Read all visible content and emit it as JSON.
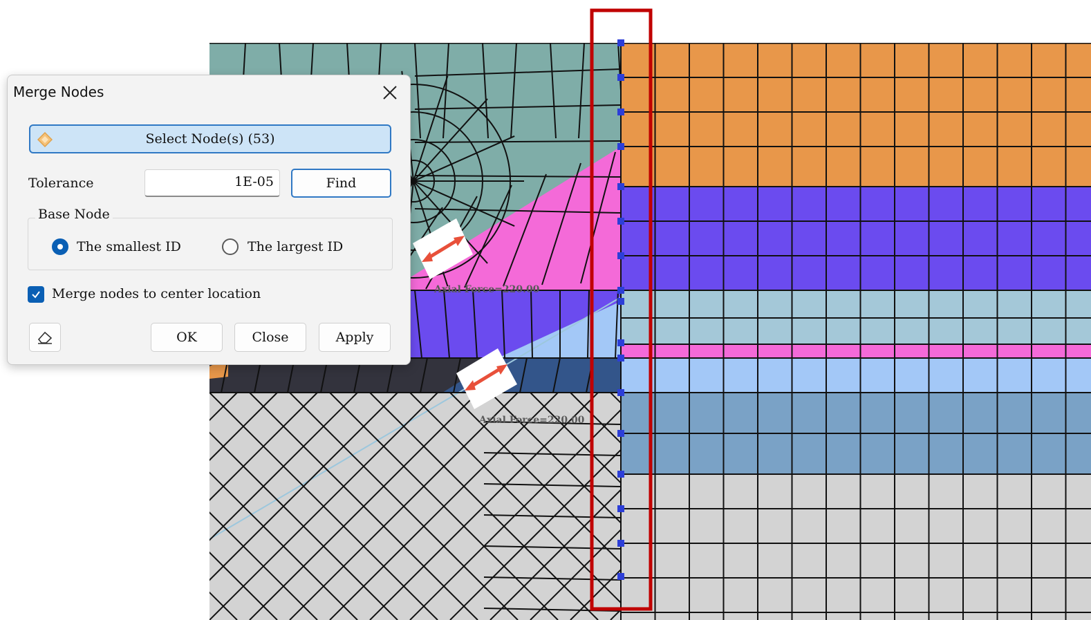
{
  "viewport": {
    "axial_label_1": "Axial Force=220.00",
    "axial_label_2": "Axial Force=220.00",
    "colors": {
      "teal": "#7fada8",
      "orange": "#e8974a",
      "pink": "#f46ad8",
      "purple": "#6b4bef",
      "light_blue": "#a4c8d8",
      "sky_blue": "#a3c8f7",
      "steel_blue": "#7aa2c6",
      "dark_blue": "#33558a",
      "dark_gray": "#33333d",
      "light_gray": "#d3d3d3",
      "node_marker": "#2c3ed8",
      "selection_box": "#c00000",
      "force_arrow": "#e8503a"
    }
  },
  "dialog": {
    "title": "Merge Nodes",
    "close_icon": "close-icon",
    "select_nodes_label": "Select Node(s) (53)",
    "select_icon": "diamond-icon",
    "tolerance_label": "Tolerance",
    "tolerance_value": "1E-05",
    "find_label": "Find",
    "base_node_legend": "Base Node",
    "radio_smallest_label": "The smallest ID",
    "radio_largest_label": "The largest ID",
    "selected_base_node": "The smallest ID",
    "merge_center_label": "Merge nodes to center location",
    "merge_center_checked": true,
    "eraser_icon": "eraser-icon",
    "ok_label": "OK",
    "close_label": "Close",
    "apply_label": "Apply"
  }
}
